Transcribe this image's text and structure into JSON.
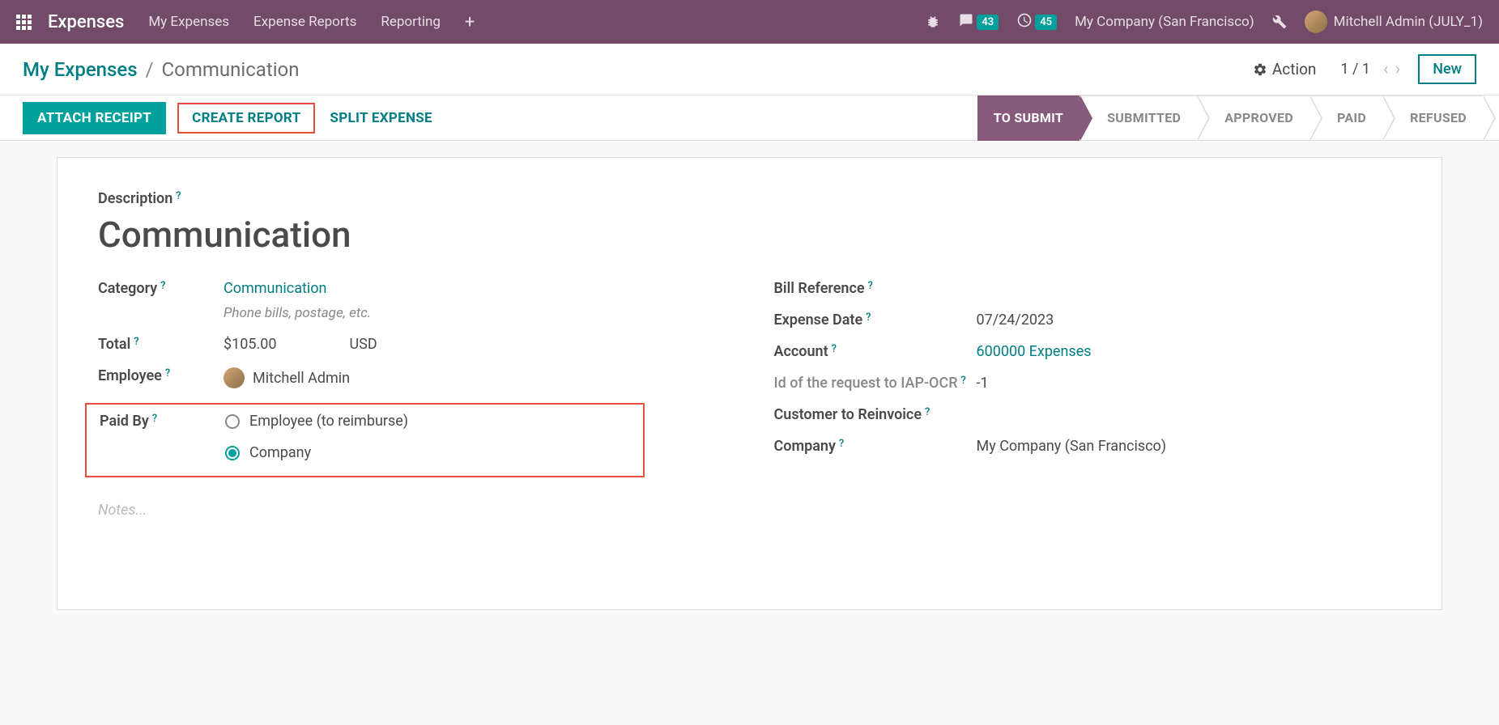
{
  "topnav": {
    "brand": "Expenses",
    "menu": [
      "My Expenses",
      "Expense Reports",
      "Reporting"
    ],
    "messages_count": "43",
    "activities_count": "45",
    "company": "My Company (San Francisco)",
    "user": "Mitchell Admin (JULY_1)"
  },
  "breadcrumb": {
    "parent": "My Expenses",
    "current": "Communication",
    "action_label": "Action",
    "pager": "1 / 1",
    "new_label": "New"
  },
  "actions": {
    "attach": "ATTACH RECEIPT",
    "create_report": "CREATE REPORT",
    "split": "SPLIT EXPENSE"
  },
  "status": {
    "steps": [
      "TO SUBMIT",
      "SUBMITTED",
      "APPROVED",
      "PAID",
      "REFUSED"
    ],
    "active": "TO SUBMIT"
  },
  "form": {
    "description_label": "Description",
    "title": "Communication",
    "left": {
      "category_label": "Category",
      "category_value": "Communication",
      "category_hint": "Phone bills, postage, etc.",
      "total_label": "Total",
      "total_value": "$105.00",
      "total_currency": "USD",
      "employee_label": "Employee",
      "employee_value": "Mitchell Admin",
      "paid_by_label": "Paid By",
      "paid_by_opt1": "Employee (to reimburse)",
      "paid_by_opt2": "Company"
    },
    "right": {
      "bill_ref_label": "Bill Reference",
      "expense_date_label": "Expense Date",
      "expense_date_value": "07/24/2023",
      "account_label": "Account",
      "account_value": "600000 Expenses",
      "iap_label": "Id of the request to IAP-OCR",
      "iap_value": "-1",
      "customer_label": "Customer to Reinvoice",
      "company_label": "Company",
      "company_value": "My Company (San Francisco)"
    },
    "notes_placeholder": "Notes..."
  }
}
